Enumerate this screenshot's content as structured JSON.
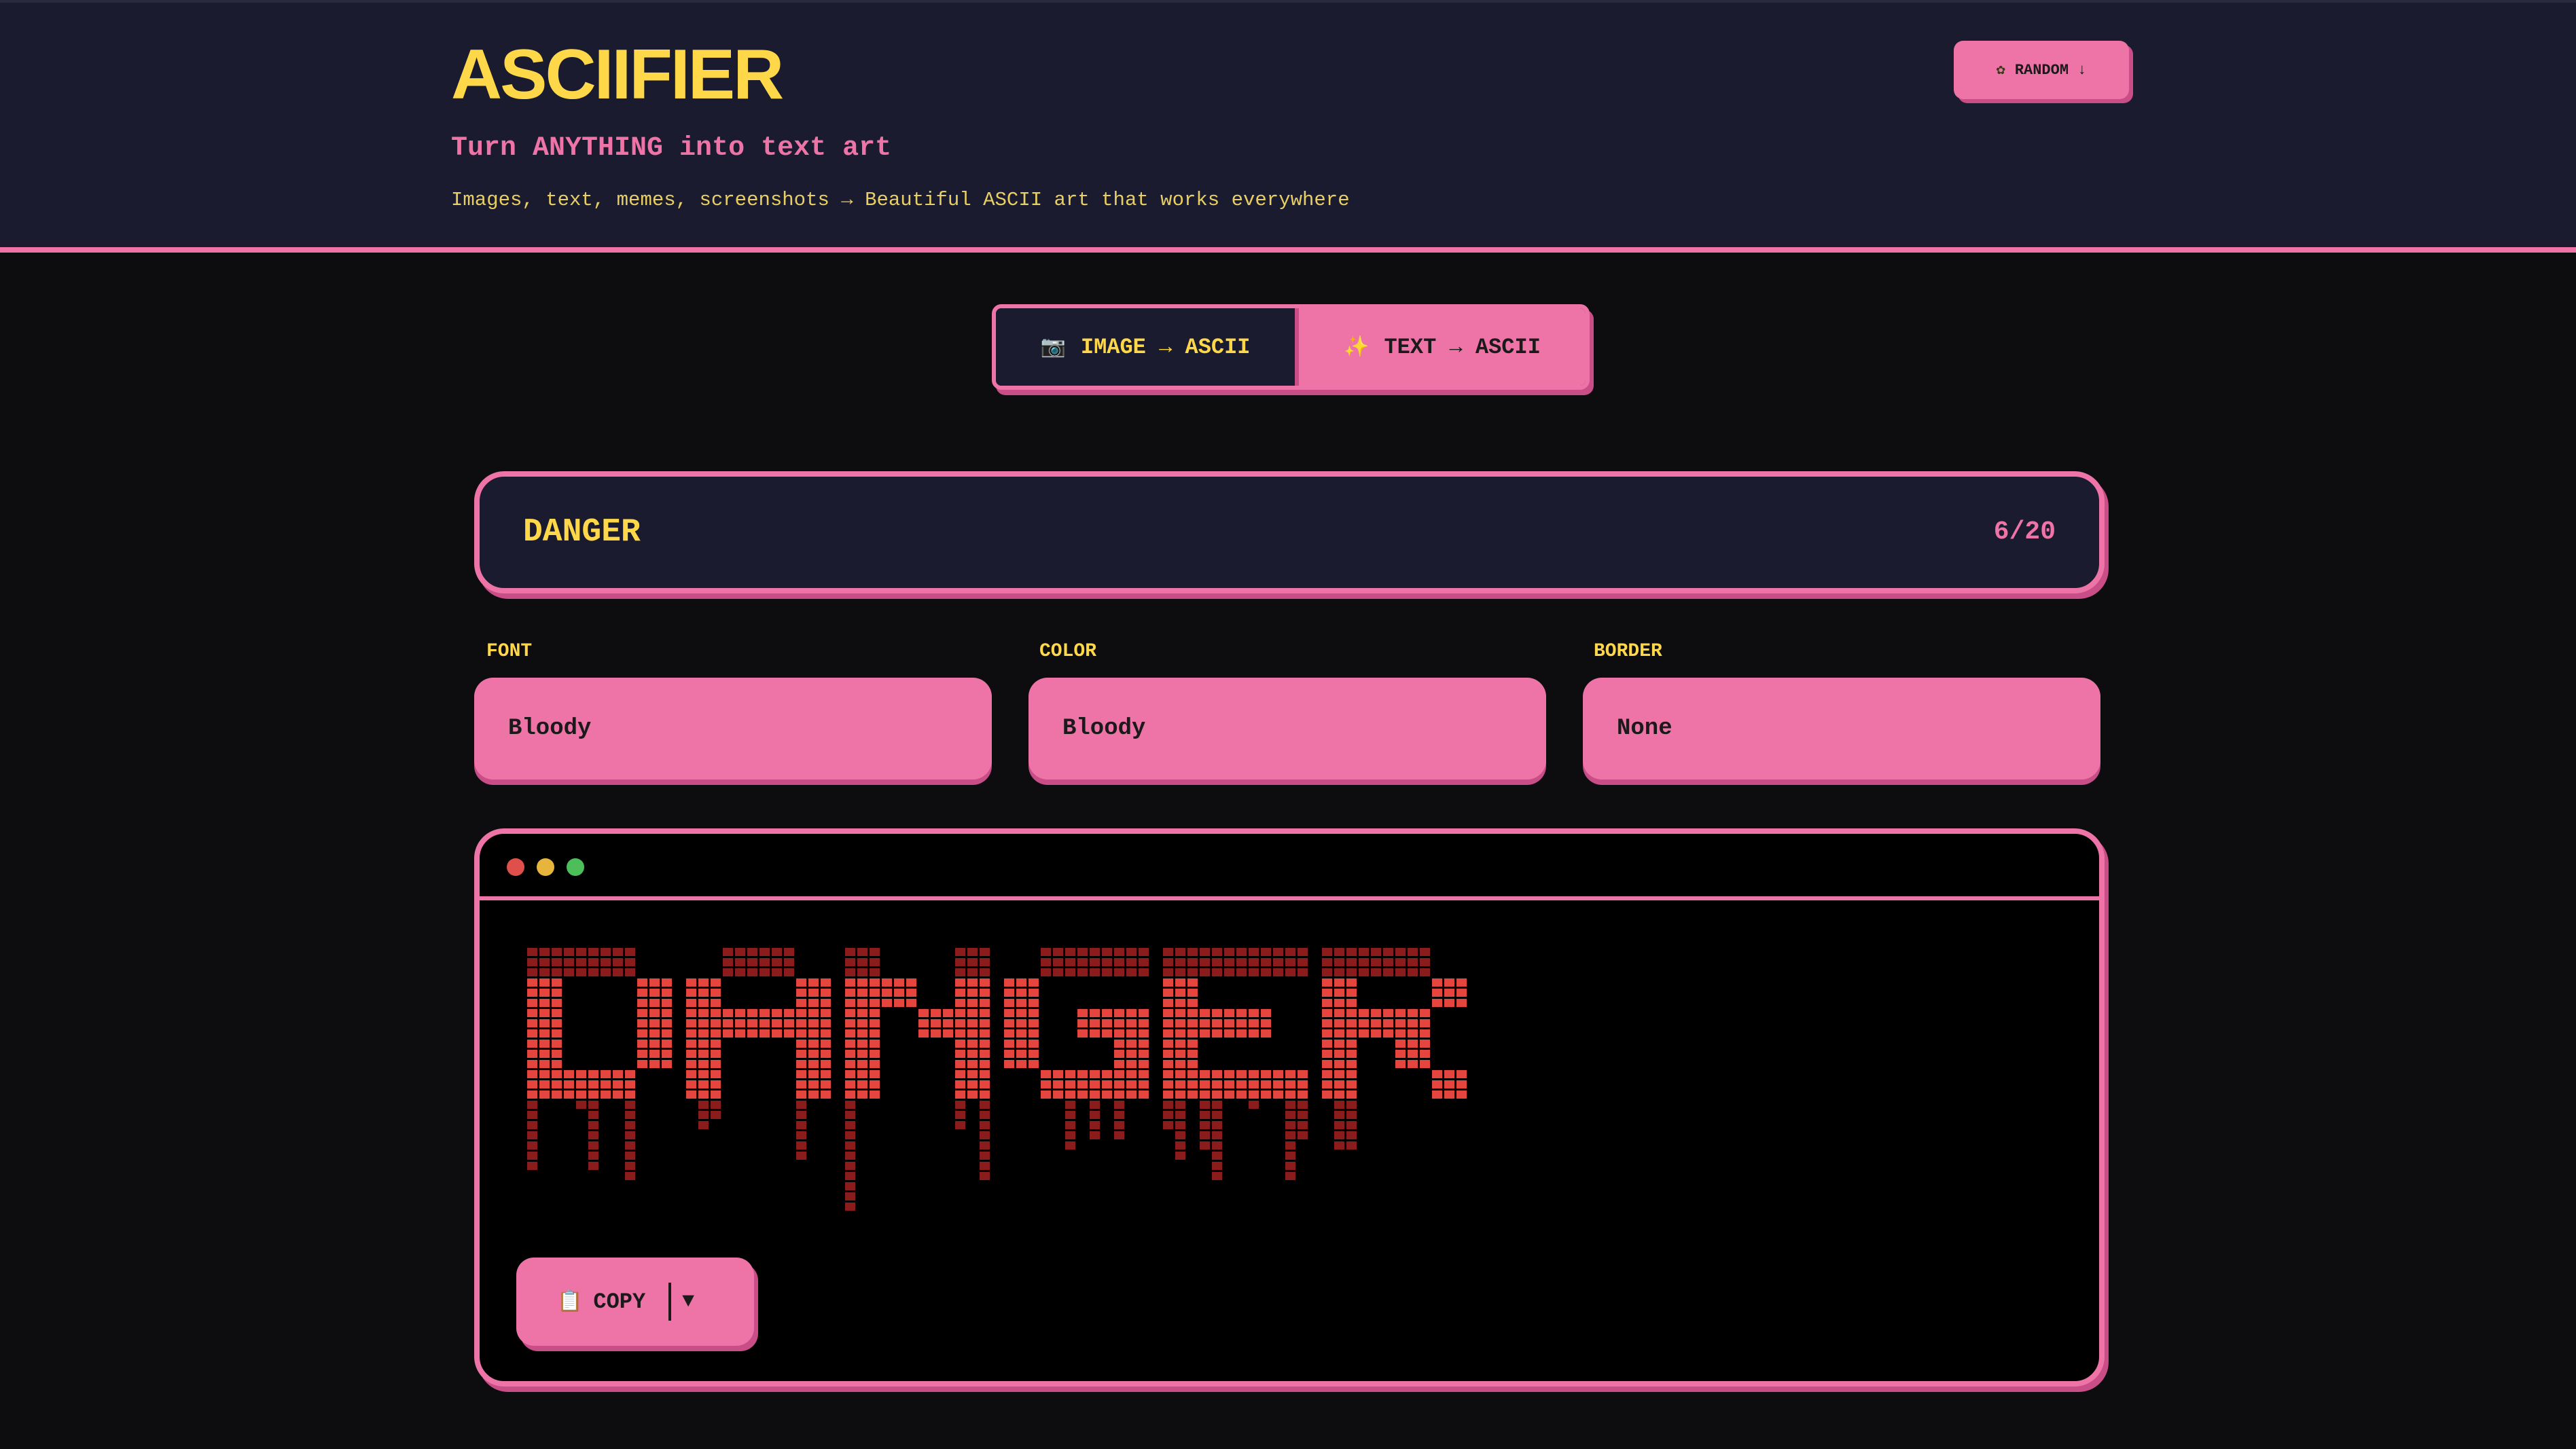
{
  "app": {
    "title": "ASCIIFIER",
    "tagline": "Turn ANYTHING into text art",
    "subtitle": "Images, text, memes, screenshots → Beautiful ASCII art that works everywhere",
    "random_icon": "✿",
    "random_label": "RANDOM ↓"
  },
  "modes": {
    "image": {
      "icon": "📷",
      "label": "IMAGE → ASCII"
    },
    "text": {
      "icon": "✨",
      "label": "TEXT → ASCII",
      "active": true
    }
  },
  "input": {
    "value": "DANGER",
    "char_count": "6/20"
  },
  "options": {
    "font": {
      "label": "FONT",
      "value": "Bloody"
    },
    "color": {
      "label": "COLOR",
      "value": "Bloody"
    },
    "border": {
      "label": "BORDER",
      "value": "None"
    }
  },
  "output": {
    "rendered_text": "DANGER",
    "copy_icon": "📋",
    "copy_label": "COPY",
    "dropdown_icon": "▼"
  },
  "colors": {
    "accent": "#ee74a8",
    "title": "#ffd84a",
    "header_bg": "#1b1b2f",
    "page_bg": "#0d0d10",
    "art_bright": "#e5453f",
    "art_dim": "#8a1c1c"
  }
}
